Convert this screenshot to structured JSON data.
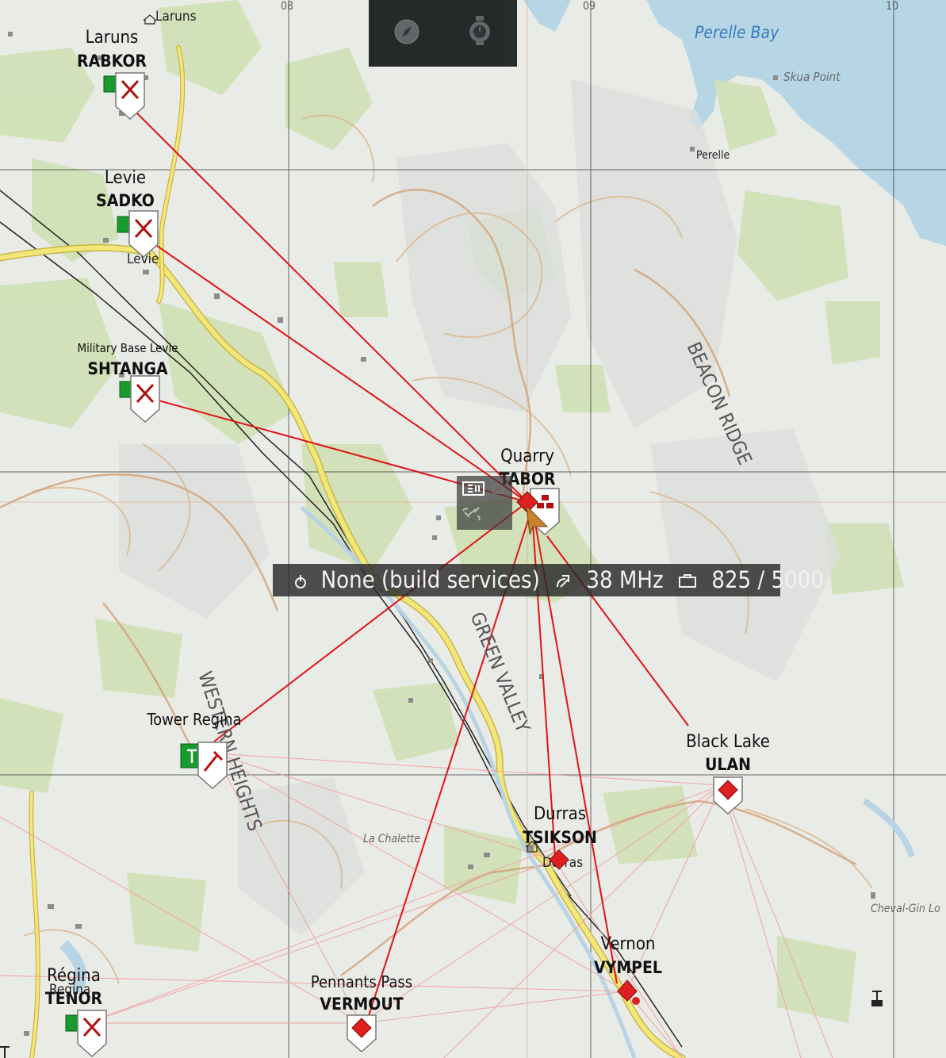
{
  "grid_labels": [
    "08",
    "09",
    "10"
  ],
  "water_labels": {
    "bay": "Perelle Bay",
    "point": "Skua Point",
    "lake": "Cheval-Gin Lo"
  },
  "terrain_labels": {
    "beacon": "BEACON RIDGE",
    "green_valley": "GREEN VALLEY",
    "western": "WESTERN HEIGHTS"
  },
  "places": {
    "laruns_small": "Laruns",
    "levie_small": "Levie",
    "perelle": "Perelle",
    "la_chalette": "La Chalette",
    "durras_small": "Durras",
    "regina_small": "Regina"
  },
  "bases": [
    {
      "id": "rabkor",
      "place": "Laruns",
      "callsign": "RABKOR"
    },
    {
      "id": "sadko",
      "place": "Levie",
      "callsign": "SADKO"
    },
    {
      "id": "shtanga",
      "place": "Military Base Levie",
      "callsign": "SHTANGA"
    },
    {
      "id": "tabor",
      "place": "Quarry",
      "callsign": "TABOR"
    },
    {
      "id": "regina_tower",
      "place": "Tower Regina",
      "callsign": ""
    },
    {
      "id": "ulan",
      "place": "Black Lake",
      "callsign": "ULAN"
    },
    {
      "id": "tsikson",
      "place": "Durras",
      "callsign": "TSIKSON"
    },
    {
      "id": "vympel",
      "place": "Vernon",
      "callsign": "VYMPEL"
    },
    {
      "id": "vermout",
      "place": "Pennants Pass",
      "callsign": "VERMOUT"
    },
    {
      "id": "tenor",
      "place": "Régina",
      "callsign": "TENOR"
    }
  ],
  "info_bar": {
    "service": "None (build services)",
    "frequency": "38 MHz",
    "supplies": "825 / 5000"
  },
  "icons": {
    "toolbar": [
      "compass-icon",
      "stopwatch-icon"
    ],
    "info": [
      "antenna-icon",
      "radio-icon",
      "supply-icon"
    ]
  },
  "colors": {
    "link": "#e01414",
    "faded_link": "#f29a9a",
    "friendly": "#189a2e",
    "enemy": "#e02020",
    "road": "#f2e46b"
  }
}
